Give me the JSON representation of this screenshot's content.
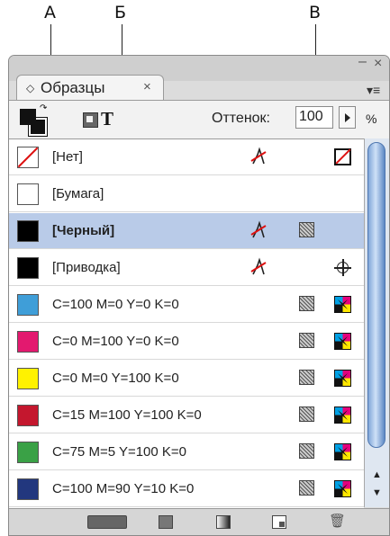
{
  "callouts": {
    "a": "A",
    "b": "Б",
    "c": "В"
  },
  "panel": {
    "tab_title": "Образцы",
    "close_glyph": "×",
    "window_minimize": "–",
    "window_close": "×",
    "menu_glyph": "▾≡"
  },
  "toolbar": {
    "format_text_glyph": "T",
    "tint_label": "Оттенок:",
    "tint_value": "100",
    "tint_unit": "%"
  },
  "swatches": [
    {
      "name": "[Нет]",
      "color": "none",
      "edit_locked": true,
      "ink": false,
      "mode": "none"
    },
    {
      "name": "[Бумага]",
      "color": "#ffffff",
      "edit_locked": false,
      "ink": false,
      "mode": ""
    },
    {
      "name": "[Черный]",
      "color": "#000000",
      "edit_locked": true,
      "ink": true,
      "mode": "",
      "selected": true
    },
    {
      "name": "[Приводка]",
      "color": "#000000",
      "edit_locked": true,
      "ink": false,
      "mode": "registration"
    },
    {
      "name": "C=100 M=0 Y=0 K=0",
      "color": "#3f9ed8",
      "edit_locked": false,
      "ink": true,
      "mode": "cmyk"
    },
    {
      "name": "C=0 M=100 Y=0 K=0",
      "color": "#e3196f",
      "edit_locked": false,
      "ink": true,
      "mode": "cmyk"
    },
    {
      "name": "C=0 M=0 Y=100 K=0",
      "color": "#fff200",
      "edit_locked": false,
      "ink": true,
      "mode": "cmyk"
    },
    {
      "name": "C=15 M=100 Y=100 K=0",
      "color": "#c4172e",
      "edit_locked": false,
      "ink": true,
      "mode": "cmyk"
    },
    {
      "name": "C=75 M=5 Y=100 K=0",
      "color": "#3aa146",
      "edit_locked": false,
      "ink": true,
      "mode": "cmyk"
    },
    {
      "name": "C=100 M=90 Y=10 K=0",
      "color": "#22377e",
      "edit_locked": false,
      "ink": true,
      "mode": "cmyk"
    }
  ],
  "scrollbar": {
    "up_glyph": "▲",
    "down_glyph": "▼"
  }
}
